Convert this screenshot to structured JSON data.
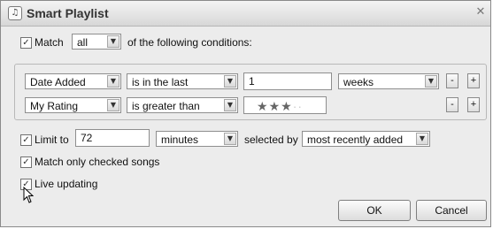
{
  "window": {
    "title": "Smart Playlist",
    "app_icon": "itunes-note-icon",
    "close_icon": "close-icon"
  },
  "match": {
    "checked": true,
    "label": "Match",
    "quantifier": "all",
    "suffix": "of the following conditions:"
  },
  "rules": [
    {
      "field": "Date Added",
      "operator": "is in the last",
      "value": "1",
      "unit": "weeks",
      "remove_label": "-",
      "add_label": "+"
    },
    {
      "field": "My Rating",
      "operator": "is greater than",
      "rating_stars": 3,
      "rating_max": 5,
      "remove_label": "-",
      "add_label": "+"
    }
  ],
  "limit": {
    "checked": true,
    "label": "Limit to",
    "value": "72",
    "unit": "minutes",
    "selected_by_label": "selected by",
    "selected_by": "most recently added"
  },
  "match_checked": {
    "checked": true,
    "label": "Match only checked songs"
  },
  "live_updating": {
    "checked": true,
    "label": "Live updating"
  },
  "buttons": {
    "ok": "OK",
    "cancel": "Cancel"
  }
}
